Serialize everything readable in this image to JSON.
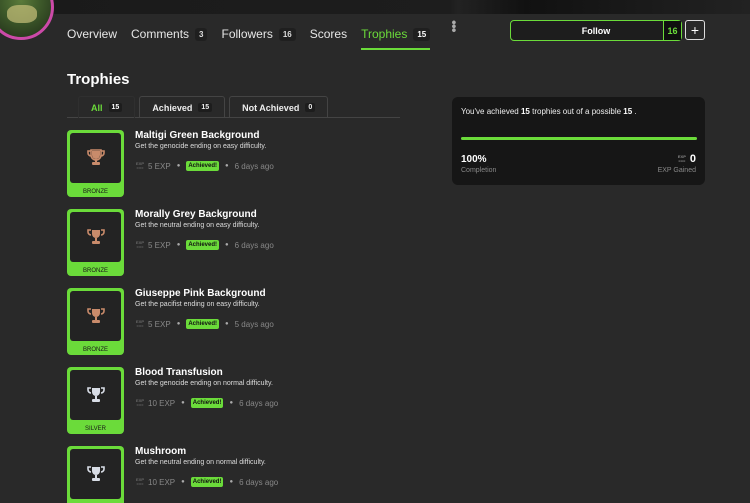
{
  "nav": {
    "items": [
      {
        "label": "Overview",
        "count": ""
      },
      {
        "label": "Comments",
        "count": "3"
      },
      {
        "label": "Followers",
        "count": "16"
      },
      {
        "label": "Scores",
        "count": ""
      },
      {
        "label": "Trophies",
        "count": "15"
      }
    ],
    "more_icon": "vertical-ellipsis-icon"
  },
  "follow": {
    "label": "Follow",
    "count": "16",
    "plus": "+"
  },
  "page_title": "Trophies",
  "filters": [
    {
      "label": "All",
      "count": "15"
    },
    {
      "label": "Achieved",
      "count": "15"
    },
    {
      "label": "Not Achieved",
      "count": "0"
    }
  ],
  "trophies": [
    {
      "name": "Maltigi Green Background",
      "desc": "Get the genocide ending on easy difficulty.",
      "exp": "5 EXP",
      "status": "Achieved!",
      "time": "6 days ago",
      "tier": "BRONZE"
    },
    {
      "name": "Morally Grey Background",
      "desc": "Get the neutral ending on easy difficulty.",
      "exp": "5 EXP",
      "status": "Achieved!",
      "time": "6 days ago",
      "tier": "BRONZE"
    },
    {
      "name": "Giuseppe Pink Background",
      "desc": "Get the pacifist ending on easy difficulty.",
      "exp": "5 EXP",
      "status": "Achieved!",
      "time": "5 days ago",
      "tier": "BRONZE"
    },
    {
      "name": "Blood Transfusion",
      "desc": "Get the genocide ending on normal difficulty.",
      "exp": "10 EXP",
      "status": "Achieved!",
      "time": "6 days ago",
      "tier": "SILVER"
    },
    {
      "name": "Mushroom",
      "desc": "Get the neutral ending on normal difficulty.",
      "exp": "10 EXP",
      "status": "Achieved!",
      "time": "6 days ago",
      "tier": ""
    }
  ],
  "summary": {
    "prefix": "You've achieved",
    "achieved": "15",
    "middle": "trophies out of a possible",
    "total": "15",
    "suffix": ".",
    "progress_percent": 100,
    "completion_value": "100%",
    "completion_label": "Completion",
    "exp_value": "0",
    "exp_label": "EXP Gained"
  },
  "exp_icon_text": [
    "EXP",
    "==="
  ],
  "colors": {
    "accent": "#6bdb3a",
    "background": "#292929",
    "panel": "#161616",
    "bronze": "#c98b6b",
    "silver": "#d8dde6"
  }
}
